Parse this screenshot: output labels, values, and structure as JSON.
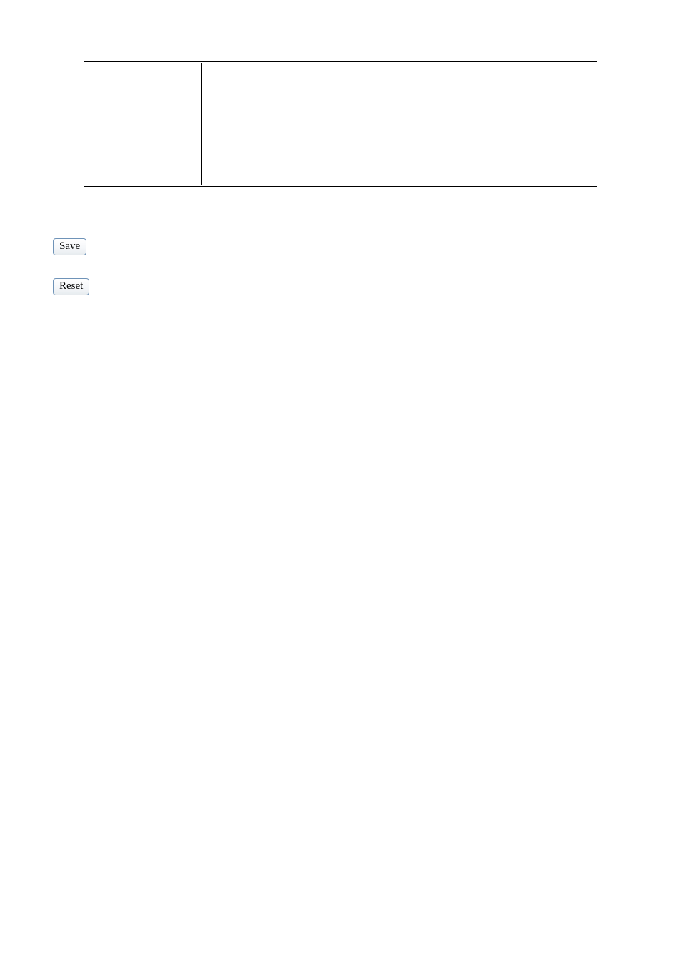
{
  "buttons": {
    "save_label": "Save",
    "reset_label": "Reset"
  },
  "table": {
    "left_cell": "",
    "right_cell": ""
  }
}
